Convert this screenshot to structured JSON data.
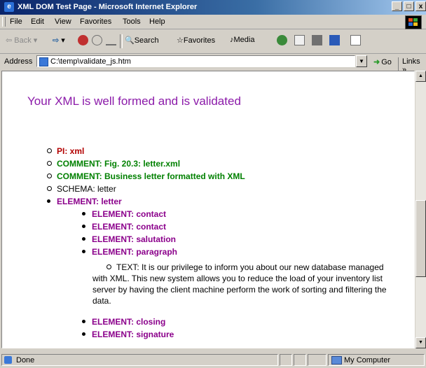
{
  "window": {
    "title": "XML DOM Test Page - Microsoft Internet Explorer"
  },
  "title_buttons": {
    "minimize": "_",
    "maximize": "□",
    "close": "x"
  },
  "menu": [
    "File",
    "Edit",
    "View",
    "Favorites",
    "Tools",
    "Help"
  ],
  "toolbar": {
    "back": "Back",
    "search": "Search",
    "favorites": "Favorites",
    "media": "Media"
  },
  "address": {
    "label": "Address",
    "value": "C:\\temp\\validate_js.htm",
    "go": "Go",
    "links": "Links »"
  },
  "page": {
    "heading": "Your XML is well formed and is validated",
    "nodes": [
      {
        "label": "PI: xml",
        "kind": "pi",
        "level": 1,
        "bullet": "circle"
      },
      {
        "label": "COMMENT: Fig. 20.3: letter.xml",
        "kind": "comment",
        "level": 1,
        "bullet": "circle"
      },
      {
        "label": "COMMENT: Business letter formatted with XML",
        "kind": "comment",
        "level": 1,
        "bullet": "circle"
      },
      {
        "label": "SCHEMA: letter",
        "kind": "schema",
        "level": 1,
        "bullet": "circle"
      },
      {
        "label": "ELEMENT: letter",
        "kind": "element",
        "level": 1,
        "bullet": "disc"
      },
      {
        "label": "ELEMENT: contact",
        "kind": "element",
        "level": 2,
        "bullet": "disc"
      },
      {
        "label": "ELEMENT: contact",
        "kind": "element",
        "level": 2,
        "bullet": "disc"
      },
      {
        "label": "ELEMENT: salutation",
        "kind": "element",
        "level": 2,
        "bullet": "disc"
      },
      {
        "label": "ELEMENT: paragraph",
        "kind": "element",
        "level": 2,
        "bullet": "disc"
      },
      {
        "label": "ELEMENT: closing",
        "kind": "element",
        "level": 2,
        "bullet": "disc"
      },
      {
        "label": "ELEMENT: signature",
        "kind": "element",
        "level": 2,
        "bullet": "disc"
      }
    ],
    "text_node": "TEXT: It is our privilege to inform you about our new database managed with XML. This new system allows you to reduce the load of your inventory list server by having the client machine perform the work of sorting and filtering the data."
  },
  "status": {
    "text": "Done",
    "zone": "My Computer"
  },
  "colors": {
    "pi": "#b30000",
    "comment": "#008000",
    "element": "#8b008b",
    "heading": "#8b1aa9"
  }
}
